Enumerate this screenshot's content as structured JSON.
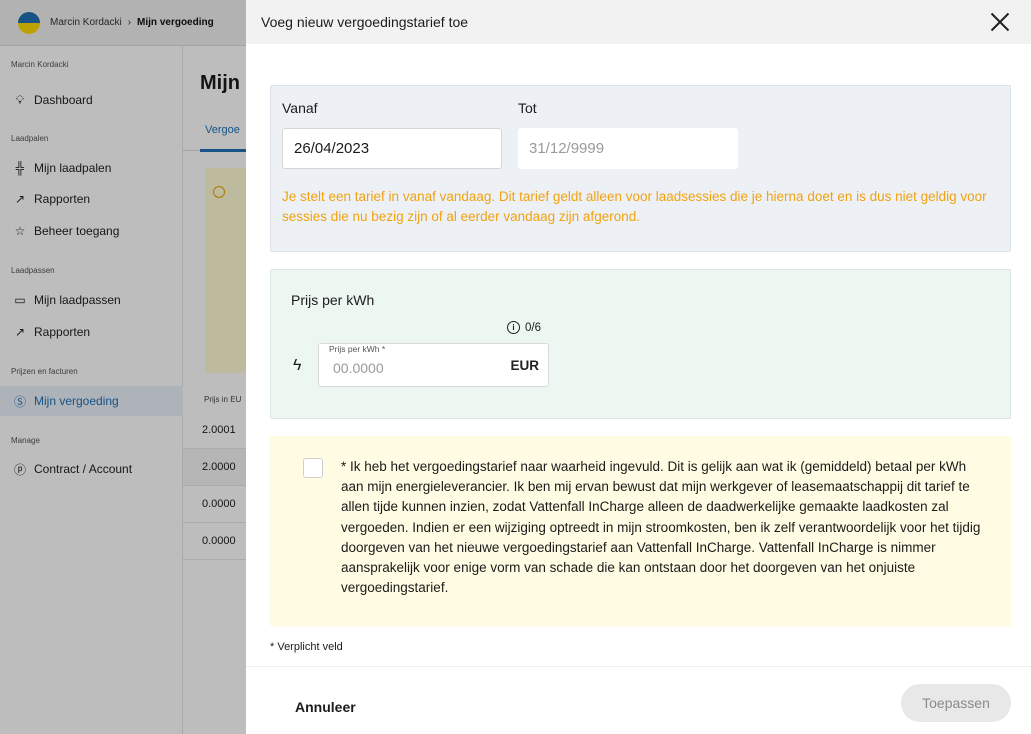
{
  "topbar": {
    "user": "Marcin Kordacki",
    "current": "Mijn vergoeding"
  },
  "sidebar": {
    "user": "Marcin Kordacki",
    "dashboard": "Dashboard",
    "sections": [
      "Laadpalen",
      "Laadpassen",
      "Prijzen en facturen",
      "Manage"
    ],
    "items": {
      "laadpalen": "Mijn laadpalen",
      "rapporten1": "Rapporten",
      "beheer": "Beheer toegang",
      "laadpassen": "Mijn laadpassen",
      "rapporten2": "Rapporten",
      "vergoeding": "Mijn vergoeding",
      "contract": "Contract / Account"
    }
  },
  "content": {
    "title": "Mijn",
    "tab": "Vergoe",
    "column": "Prijs in EU",
    "rows": [
      "2.0001",
      "2.0000",
      "0.0000",
      "0.0000"
    ]
  },
  "drawer": {
    "title": "Voeg nieuw vergoedingstarief toe",
    "from_label": "Vanaf",
    "to_label": "Tot",
    "from_value": "26/04/2023",
    "to_value": "31/12/9999",
    "warning": "Je stelt een tarief in vanaf vandaag. Dit tarief geldt alleen voor laadsessies die je hierna doet en is dus niet geldig voor sessies die nu bezig zijn of al eerder vandaag zijn afgerond.",
    "price_title": "Prijs per kWh",
    "counter": "0/6",
    "price_label": "Prijs per kWh *",
    "price_placeholder": "00.0000",
    "price_unit": "EUR",
    "consent": "* Ik heb het vergoedingstarief naar waarheid ingevuld. Dit is gelijk aan wat ik (gemiddeld) betaal per kWh aan mijn energieleverancier. Ik ben mij ervan bewust dat mijn werkgever of leasemaatschappij dit tarief te allen tijde kunnen inzien, zodat Vattenfall InCharge alleen de daadwerkelijke gemaakte laadkosten zal vergoeden. Indien er een wijziging optreedt in mijn stroomkosten, ben ik zelf verantwoordelijk voor het tijdig doorgeven van het nieuwe vergoedingstarief aan Vattenfall InCharge. Vattenfall InCharge is nimmer aansprakelijk voor enige vorm van schade die kan ontstaan door het doorgeven van het onjuiste vergoedingstarief.",
    "required_note": "* Verplicht veld",
    "cancel": "Annuleer",
    "apply": "Toepassen"
  },
  "colors": {
    "brand_blue": "#2071b5",
    "warning": "#f1a20f",
    "date_box": "#edf1f6",
    "price_box": "#edf7f2",
    "consent_box": "#fffce3"
  }
}
